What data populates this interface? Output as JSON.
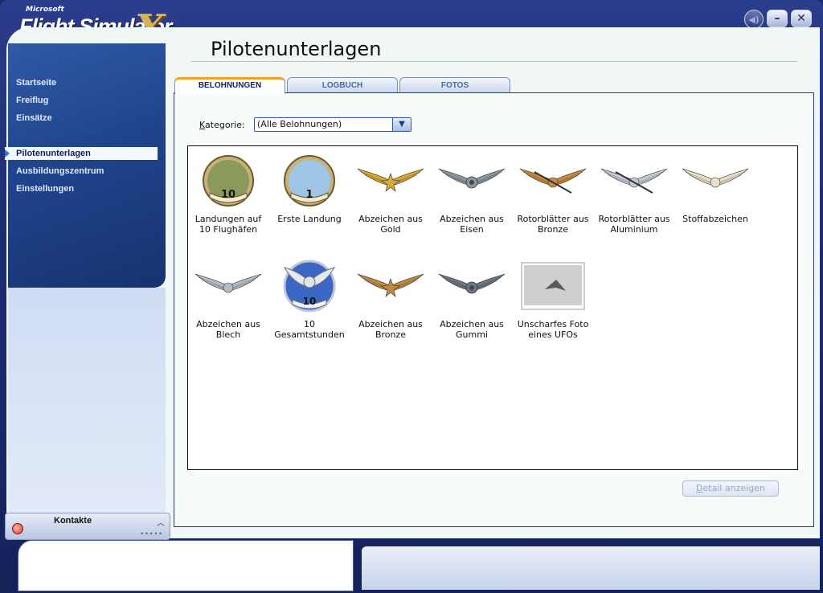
{
  "app": {
    "logo_small": "Microsoft",
    "logo_main": "Flight Simulator",
    "logo_x": "X"
  },
  "window_buttons": {
    "minimize": "–",
    "close": "✕"
  },
  "nav": {
    "items": [
      {
        "label": "Startseite"
      },
      {
        "label": "Freiflug"
      },
      {
        "label": "Einsätze"
      },
      {
        "label": "Pilotenunterlagen"
      },
      {
        "label": "Ausbildungszentrum"
      },
      {
        "label": "Einstellungen"
      }
    ],
    "active": "Pilotenunterlagen"
  },
  "contacts": {
    "label": "Kontakte"
  },
  "page": {
    "title": "Pilotenunterlagen"
  },
  "tabs": [
    {
      "label": "BELOHNUNGEN",
      "active": true
    },
    {
      "label": "LOGBUCH",
      "active": false
    },
    {
      "label": "FOTOS",
      "active": false
    }
  ],
  "filter": {
    "label_underlined": "K",
    "label_rest": "ategorie:",
    "selected": "(Alle Belohnungen)"
  },
  "awards": [
    {
      "line1": "Landungen auf",
      "line2": "10 Flughäfen",
      "icon": "globe-badge-10",
      "badge": "10"
    },
    {
      "line1": "Erste Landung",
      "line2": "",
      "icon": "airliner-badge-1",
      "badge": "1"
    },
    {
      "line1": "Abzeichen aus",
      "line2": "Gold",
      "icon": "gold-wings",
      "color": "#d9a733"
    },
    {
      "line1": "Abzeichen aus",
      "line2": "Eisen",
      "icon": "iron-wings",
      "color": "#8a98a0"
    },
    {
      "line1": "Rotorblätter aus",
      "line2": "Bronze",
      "icon": "bronze-rotor-wings",
      "color": "#c98a3f"
    },
    {
      "line1": "Rotorblätter aus",
      "line2": "Aluminium",
      "icon": "aluminium-rotor-wings",
      "color": "#c5ccd8"
    },
    {
      "line1": "Stoffabzeichen",
      "line2": "",
      "icon": "cloth-wings",
      "color": "#e8e0c8"
    },
    {
      "line1": "Abzeichen aus",
      "line2": "Blech",
      "icon": "tin-wings",
      "color": "#b4bcc6"
    },
    {
      "line1": "10",
      "line2": "Gesamtstunden",
      "icon": "wings-badge-10",
      "badge": "10"
    },
    {
      "line1": "Abzeichen aus",
      "line2": "Bronze",
      "icon": "bronze-wings",
      "color": "#c08a44"
    },
    {
      "line1": "Abzeichen aus",
      "line2": "Gummi",
      "icon": "rubber-wings",
      "color": "#6e7784"
    },
    {
      "line1": "Unscharfes Foto",
      "line2": "eines UFOs",
      "icon": "ufo-photo"
    }
  ],
  "detail_button": {
    "underlined": "D",
    "rest": "etail anzeigen"
  }
}
